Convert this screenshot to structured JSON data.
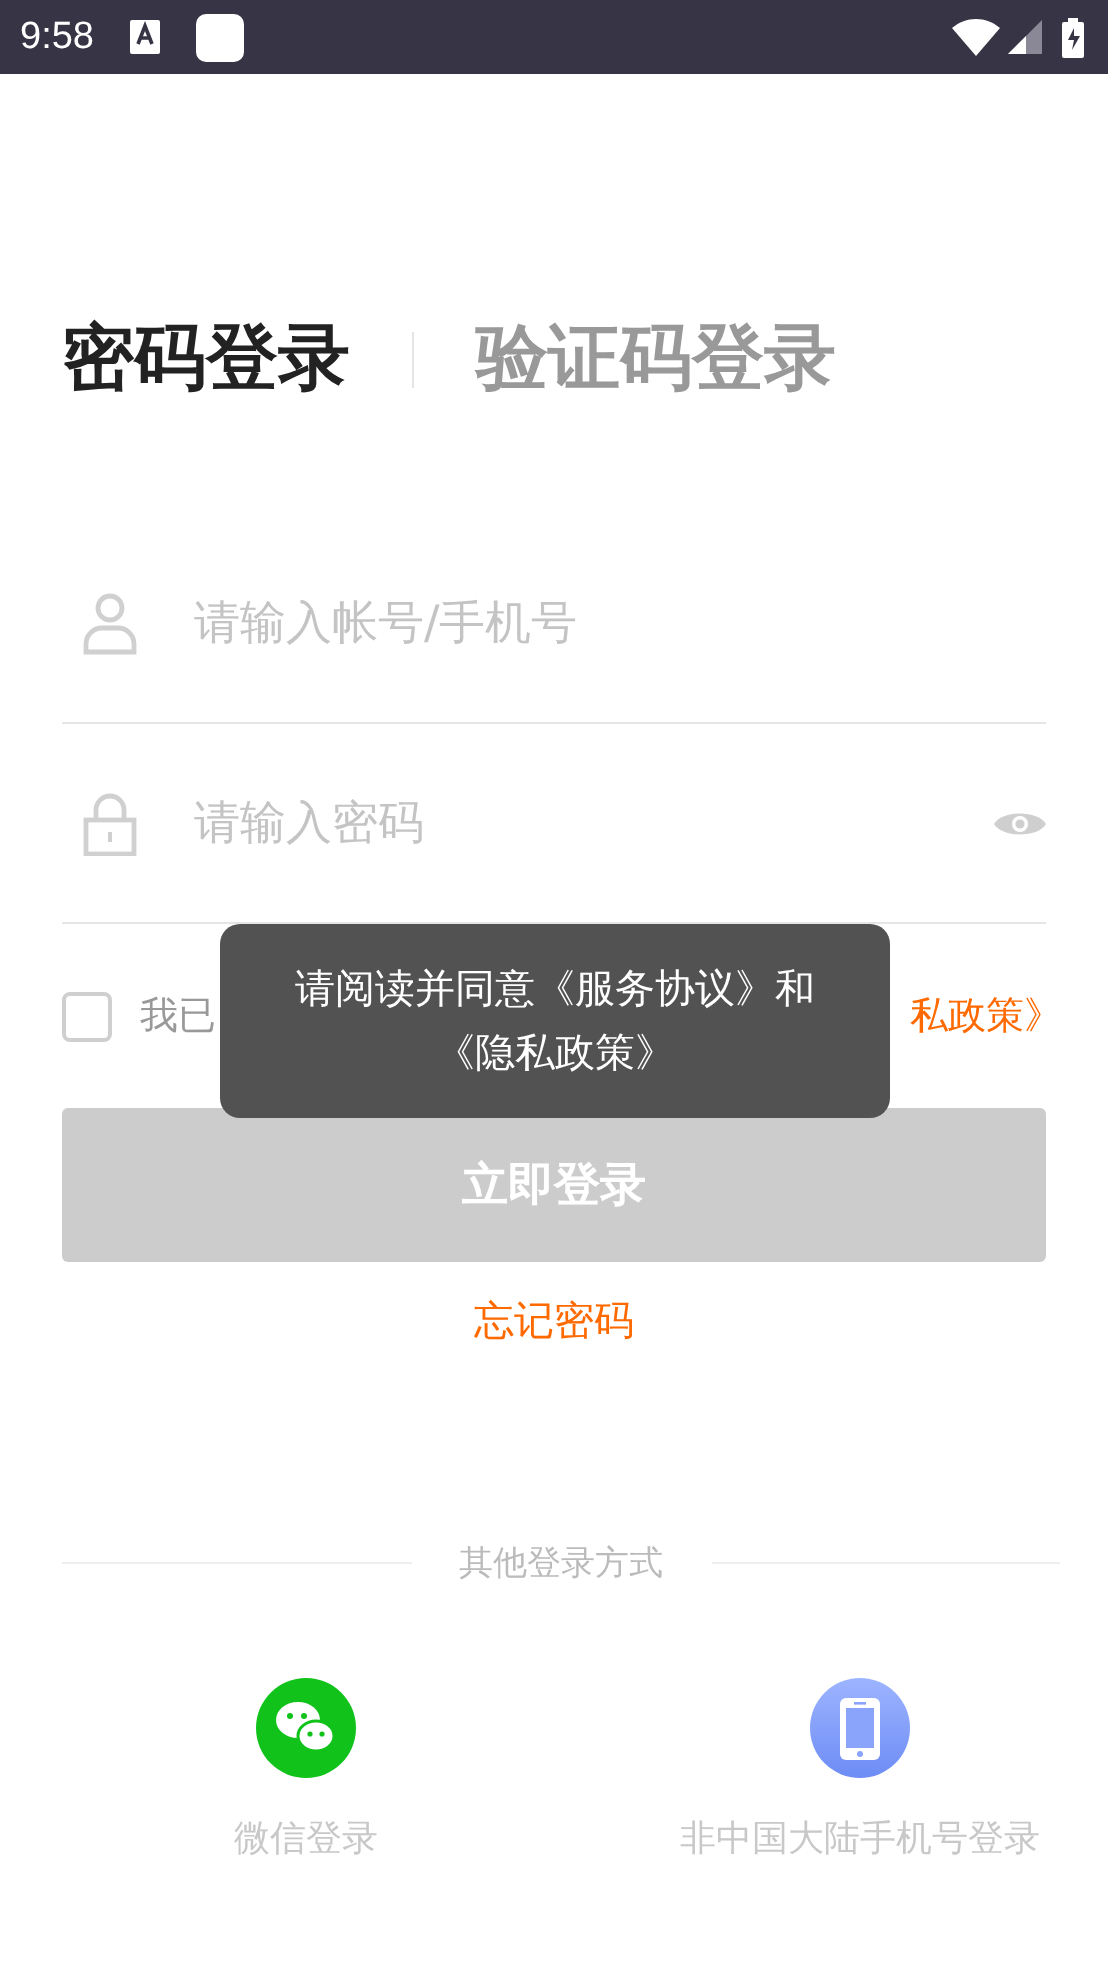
{
  "status_bar": {
    "time": "9:58"
  },
  "tabs": [
    {
      "label": "密码登录",
      "selected": true
    },
    {
      "label": "验证码登录",
      "selected": false
    }
  ],
  "fields": [
    {
      "kind": "account",
      "placeholder": "请输入帐号/手机号"
    },
    {
      "kind": "password",
      "placeholder": "请输入密码"
    }
  ],
  "agreement": {
    "checked": false,
    "lead": "我已",
    "link": "私政策》"
  },
  "login_button": {
    "label": "立即登录",
    "disabled": true
  },
  "forgot_password": "忘记密码",
  "other_login": {
    "title": "其他登录方式",
    "options": [
      {
        "kind": "wechat",
        "label": "微信登录"
      },
      {
        "kind": "phone",
        "label": "非中国大陆手机号登录"
      }
    ]
  },
  "toast": {
    "text": "请阅读并同意《服务协议》和《隐私政策》"
  }
}
